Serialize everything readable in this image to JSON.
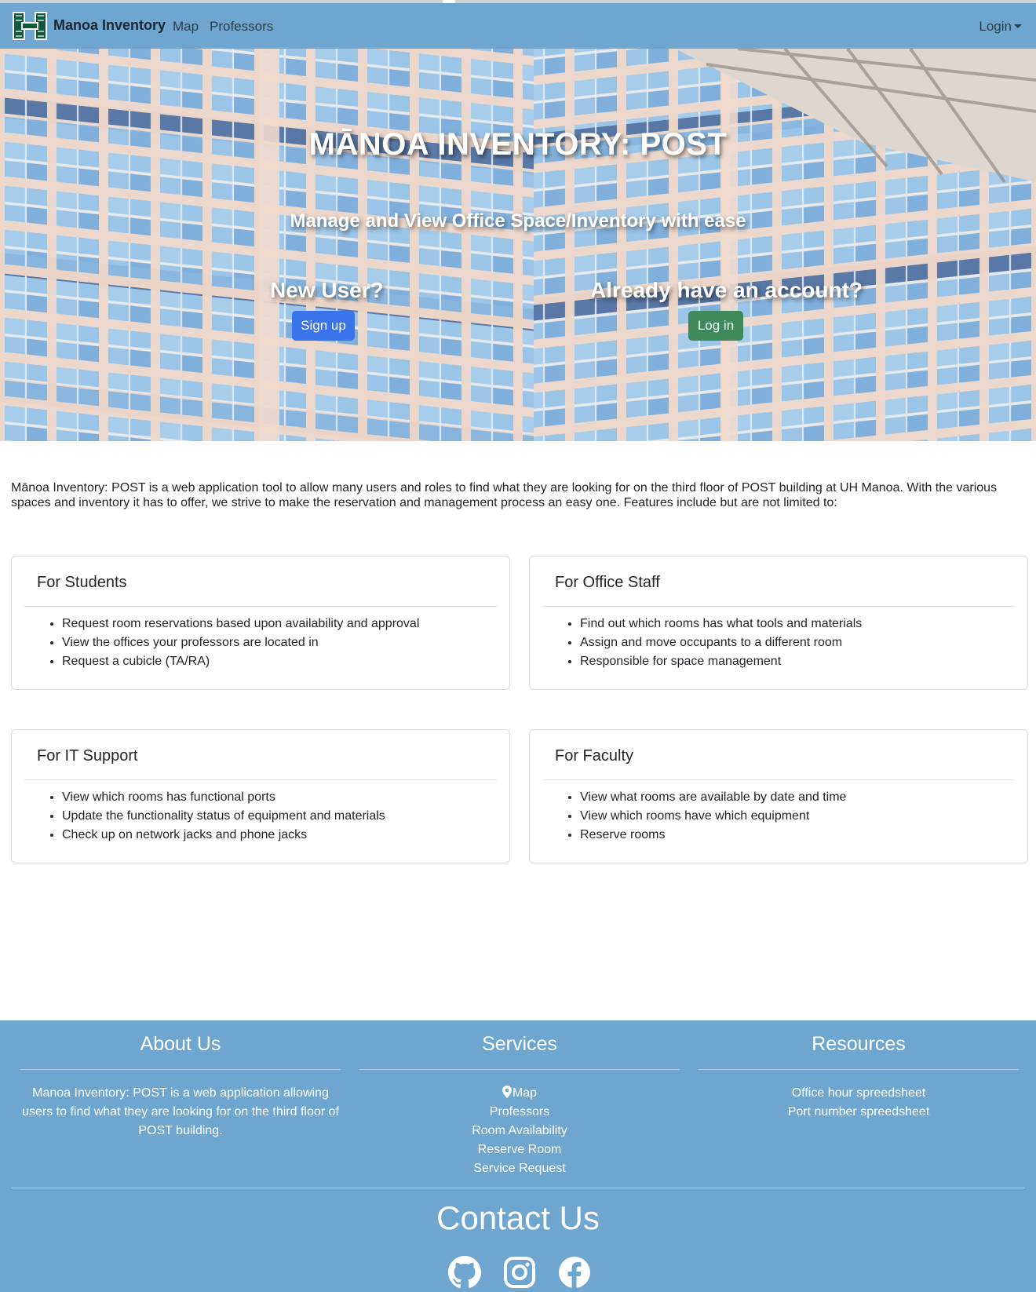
{
  "navbar": {
    "brand": "Manoa Inventory",
    "links": [
      "Map",
      "Professors"
    ],
    "login": "Login"
  },
  "hero": {
    "title": "MĀNOA INVENTORY: POST",
    "subtitle": "Manage and View Office Space/Inventory with ease",
    "new_user_prompt": "New User?",
    "signup_label": "Sign up",
    "existing_prompt": "Already have an account?",
    "login_label": "Log in"
  },
  "intro": "Mānoa Inventory: POST is a web application tool to allow many users and roles to find what they are looking for on the third floor of POST building at UH Manoa. With the various spaces and inventory it has to offer, we strive to make the reservation and management process an easy one. Features include but are not limited to:",
  "cards": [
    {
      "title": "For Students",
      "items": [
        "Request room reservations based upon availability and approval",
        "View the offices your professors are located in",
        "Request a cubicle (TA/RA)"
      ]
    },
    {
      "title": "For Office Staff",
      "items": [
        "Find out which rooms has what tools and materials",
        "Assign and move occupants to a different room",
        "Responsible for space management"
      ]
    },
    {
      "title": "For IT Support",
      "items": [
        "View which rooms has functional ports",
        "Update the functionality status of equipment and materials",
        "Check up on network jacks and phone jacks"
      ]
    },
    {
      "title": "For Faculty",
      "items": [
        "View what rooms are available by date and time",
        "View which rooms have which equipment",
        "Reserve rooms"
      ]
    }
  ],
  "footer": {
    "about": {
      "title": "About Us",
      "text": "Manoa Inventory: POST is a web application allowing users to find what they are looking for on the third floor of POST building."
    },
    "services": {
      "title": "Services",
      "links": [
        "Map",
        "Professors",
        "Room Availability",
        "Reserve Room",
        "Service Request"
      ]
    },
    "resources": {
      "title": "Resources",
      "links": [
        "Office hour spreedsheet",
        "Port number spreedsheet"
      ]
    },
    "contact_title": "Contact Us",
    "social_icons": [
      "github-icon",
      "instagram-icon",
      "facebook-icon"
    ]
  },
  "colors": {
    "navbar": "#6ea6cf",
    "footer": "#6ea6cf",
    "signup_button": "#3b73ea",
    "login_button": "#3e8a5c"
  }
}
